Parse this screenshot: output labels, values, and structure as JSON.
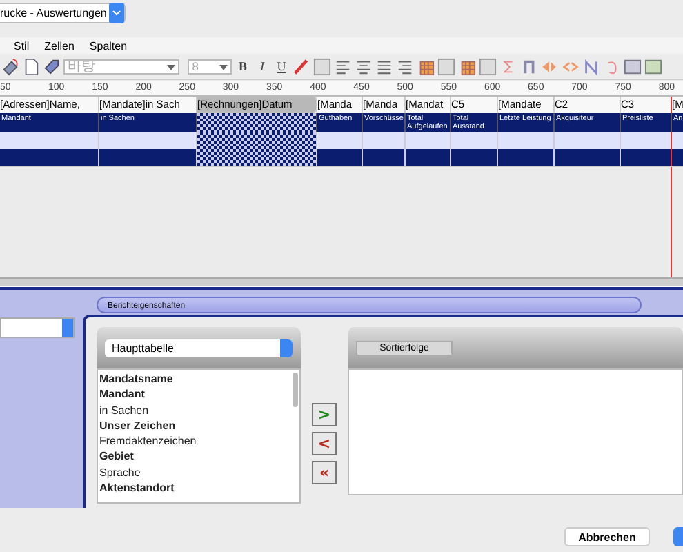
{
  "report_select": {
    "value": "rucke - Auswertungen"
  },
  "menu": [
    "Stil",
    "Zellen",
    "Spalten"
  ],
  "toolbar": {
    "font_field": {
      "placeholder": "바탕"
    },
    "size_field": {
      "placeholder": "8"
    },
    "style_buttons": [
      "B",
      "I",
      "U"
    ]
  },
  "ruler": [
    "50",
    "100",
    "150",
    "200",
    "250",
    "300",
    "350",
    "400",
    "450",
    "500",
    "550",
    "600",
    "650",
    "700",
    "750",
    "800"
  ],
  "columns": [
    {
      "header": "[Adressen]Name,",
      "label": "Mandant",
      "selected": false
    },
    {
      "header": "[Mandate]in Sach",
      "label": "in Sachen",
      "selected": false
    },
    {
      "header": "[Rechnungen]Datum",
      "selected": true
    },
    {
      "header": "[Manda",
      "label": "Guthaben",
      "selected": false
    },
    {
      "header": "[Manda",
      "label": "Vorschüsse",
      "selected": false
    },
    {
      "header": "[Mandat",
      "label": "Total Aufgelaufen",
      "selected": false
    },
    {
      "header": "C5",
      "label": "Total Ausstand",
      "selected": false
    },
    {
      "header": "[Mandate",
      "label": "Letzte Leistung",
      "selected": false
    },
    {
      "header": "C2",
      "label": "Akquisiteur",
      "selected": false
    },
    {
      "header": "C3",
      "label": "Preisliste",
      "selected": false
    },
    {
      "header": "[M",
      "label": "An",
      "selected": false
    }
  ],
  "dialog": {
    "tab": "Berichteigenschaften",
    "table_select": {
      "value": "Haupttabelle"
    },
    "fields": [
      {
        "name": "Mandatsname",
        "bold": true
      },
      {
        "name": "Mandant",
        "bold": true
      },
      {
        "name": "in Sachen",
        "bold": false
      },
      {
        "name": "Unser Zeichen",
        "bold": true
      },
      {
        "name": "Fremdaktenzeichen",
        "bold": false
      },
      {
        "name": "Gebiet",
        "bold": true
      },
      {
        "name": "Sprache",
        "bold": false
      },
      {
        "name": "Aktenstandort",
        "bold": true
      }
    ],
    "move_buttons": [
      {
        "kind": "add",
        "label": ">"
      },
      {
        "kind": "remove",
        "label": "<"
      },
      {
        "kind": "remove_all",
        "label": "«"
      }
    ],
    "sort_header": "Sortierfolge",
    "cancel_button": "Abbrechen"
  }
}
